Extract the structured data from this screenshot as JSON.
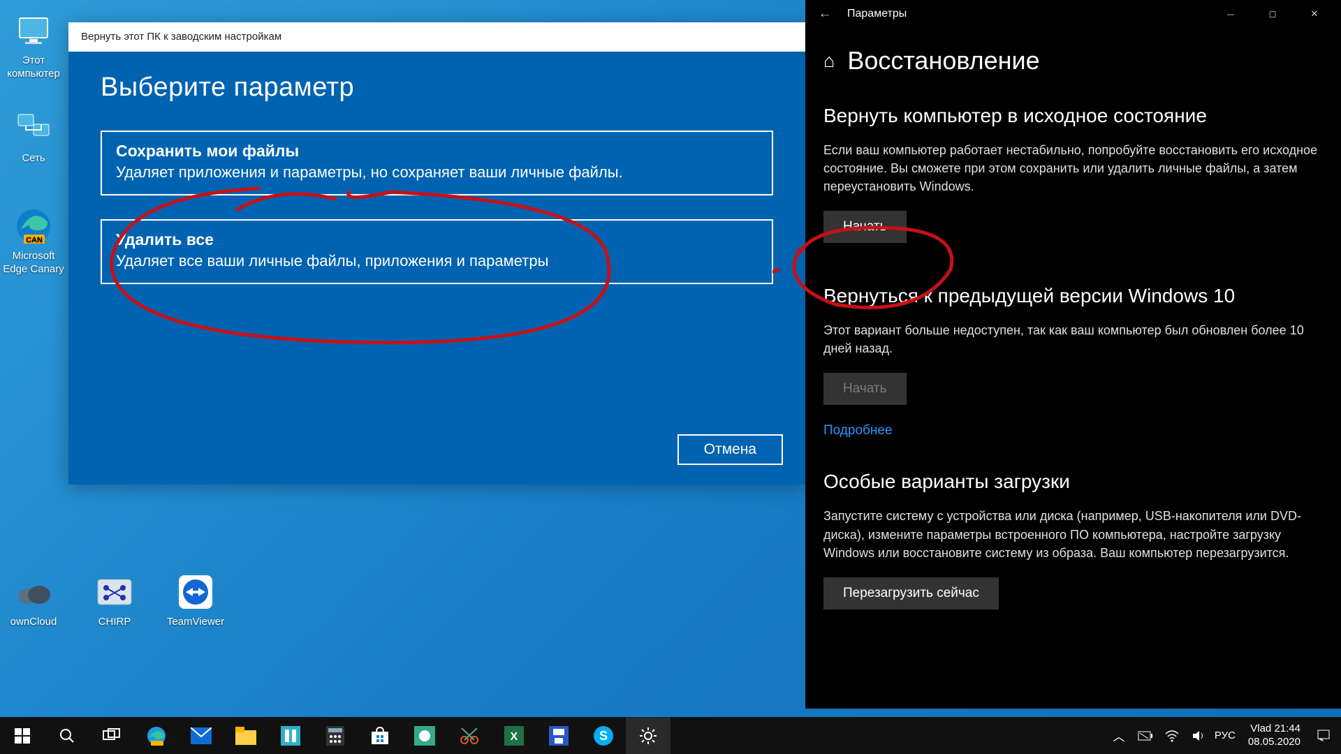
{
  "desktop_icons": {
    "this_pc": "Этот\nкомпьютер",
    "network": "Сеть",
    "edge": "Microsoft\nEdge Canary",
    "owncloud": "ownCloud",
    "chirp": "CHIRP",
    "teamviewer": "TeamViewer"
  },
  "reset": {
    "window_title": "Вернуть этот ПК к заводским настройкам",
    "heading": "Выберите параметр",
    "opt1_title": "Сохранить мои файлы",
    "opt1_desc": "Удаляет приложения и параметры, но сохраняет ваши личные файлы.",
    "opt2_title": "Удалить все",
    "opt2_desc": "Удаляет все ваши личные файлы, приложения и параметры",
    "cancel": "Отмена"
  },
  "settings": {
    "title": "Параметры",
    "page": "Восстановление",
    "s1_h": "Вернуть компьютер в исходное состояние",
    "s1_p": "Если ваш компьютер работает нестабильно, попробуйте восстановить его исходное состояние. Вы сможете при этом сохранить или удалить личные файлы, а затем переустановить Windows.",
    "s1_btn": "Начать",
    "s2_h": "Вернуться к предыдущей версии Windows 10",
    "s2_p": "Этот вариант больше недоступен, так как ваш компьютер был обновлен более 10 дней назад.",
    "s2_btn": "Начать",
    "more": "Подробнее",
    "s3_h": "Особые варианты загрузки",
    "s3_p": "Запустите систему с устройства или диска (например, USB-накопителя или DVD-диска), измените параметры встроенного ПО компьютера, настройте загрузку Windows или восстановите систему из образа. Ваш компьютер перезагрузится.",
    "s3_btn": "Перезагрузить сейчас"
  },
  "taskbar": {
    "lang": "РУС",
    "user": "Vlad",
    "time": "21:44",
    "date": "08.05.2020"
  }
}
